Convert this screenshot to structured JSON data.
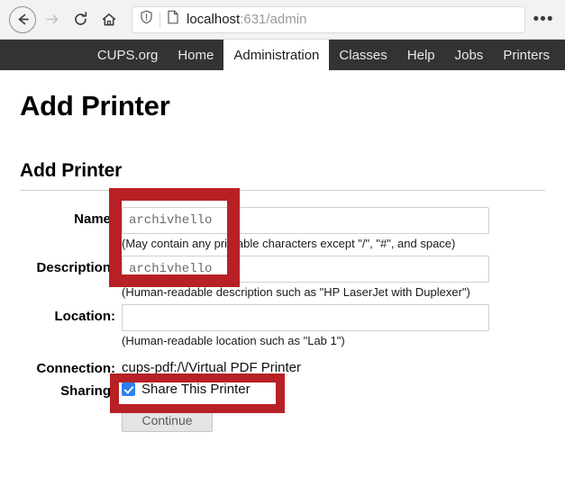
{
  "browser": {
    "back_icon": "back-arrow-icon",
    "forward_icon": "forward-arrow-icon",
    "reload_icon": "reload-icon",
    "home_icon": "home-icon",
    "shield_icon": "shield-icon",
    "page_icon": "page-document-icon",
    "url_host": "localhost",
    "url_path": ":631/admin",
    "menu_label": "•••"
  },
  "nav": {
    "items": [
      {
        "label": "CUPS.org",
        "active": false
      },
      {
        "label": "Home",
        "active": false
      },
      {
        "label": "Administration",
        "active": true
      },
      {
        "label": "Classes",
        "active": false
      },
      {
        "label": "Help",
        "active": false
      },
      {
        "label": "Jobs",
        "active": false
      },
      {
        "label": "Printers",
        "active": false
      }
    ]
  },
  "page": {
    "title": "Add Printer",
    "section_title": "Add Printer"
  },
  "form": {
    "name": {
      "label": "Name:",
      "value": "archivhello",
      "hint": "(May contain any printable characters except \"/\", \"#\", and space)"
    },
    "description": {
      "label": "Description:",
      "value": "archivhello",
      "hint": "(Human-readable description such as \"HP LaserJet with Duplexer\")"
    },
    "location": {
      "label": "Location:",
      "value": "",
      "hint": "(Human-readable location such as \"Lab 1\")"
    },
    "connection": {
      "label": "Connection:",
      "value": "cups-pdf:/\\/Virtual PDF Printer"
    },
    "sharing": {
      "label": "Sharing:",
      "checkbox_label": "Share This Printer",
      "checked": true
    },
    "continue_label": "Continue"
  },
  "annotations": {
    "color": "#b72025",
    "boxes": [
      {
        "name": "name-description-highlight"
      },
      {
        "name": "share-printer-highlight"
      }
    ]
  }
}
